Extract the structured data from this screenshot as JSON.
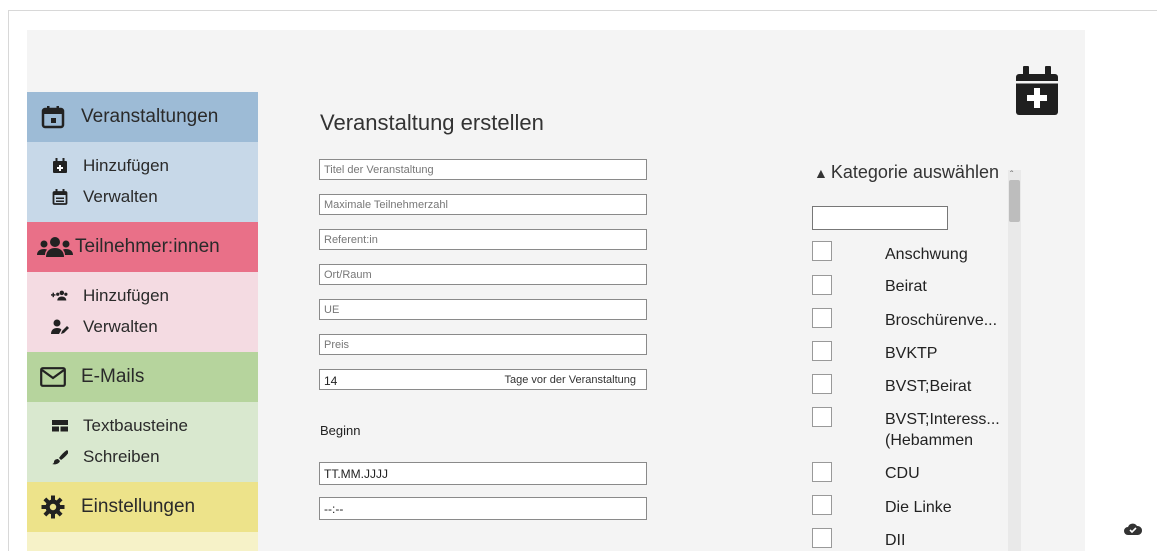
{
  "sidebar": {
    "veranstaltungen": {
      "label": "Veranstaltungen",
      "color": "#9dbbd6",
      "sub_color": "#c7d8e8",
      "items": [
        {
          "label": "Hinzufügen"
        },
        {
          "label": "Verwalten"
        }
      ]
    },
    "teilnehmer": {
      "label": "Teilnehmer:innen",
      "color": "#e97088",
      "sub_color": "#f4dbe2",
      "items": [
        {
          "label": "Hinzufügen"
        },
        {
          "label": "Verwalten"
        }
      ]
    },
    "emails": {
      "label": "E-Mails",
      "color": "#b6d49d",
      "sub_color": "#d9e8cf",
      "items": [
        {
          "label": "Textbausteine"
        },
        {
          "label": "Schreiben"
        }
      ]
    },
    "einstellungen": {
      "label": "Einstellungen",
      "color": "#ede38a"
    }
  },
  "main": {
    "title": "Veranstaltung erstellen",
    "fields": {
      "titel": {
        "placeholder": "Titel der Veranstaltung"
      },
      "max": {
        "placeholder": "Maximale Teilnehmerzahl"
      },
      "referent": {
        "placeholder": "Referent:in"
      },
      "ort": {
        "placeholder": "Ort/Raum"
      },
      "ue": {
        "placeholder": "UE"
      },
      "preis": {
        "placeholder": "Preis"
      },
      "tage": {
        "value": "14",
        "suffix": "Tage vor der Veranstaltung"
      }
    },
    "beginn_label": "Beginn",
    "date_placeholder": "TT.MM.JJJJ",
    "time_placeholder": "--:--"
  },
  "kategorie": {
    "title": "Kategorie auswählen",
    "items": [
      {
        "label": "Anschwung"
      },
      {
        "label": "Beirat"
      },
      {
        "label": "Broschürenve..."
      },
      {
        "label": "BVKTP"
      },
      {
        "label": "BVST;Beirat"
      },
      {
        "label": "BVST;Interess...",
        "label2": "(Hebammen"
      },
      {
        "label": "CDU"
      },
      {
        "label": "Die Linke"
      },
      {
        "label": "DII"
      }
    ]
  }
}
